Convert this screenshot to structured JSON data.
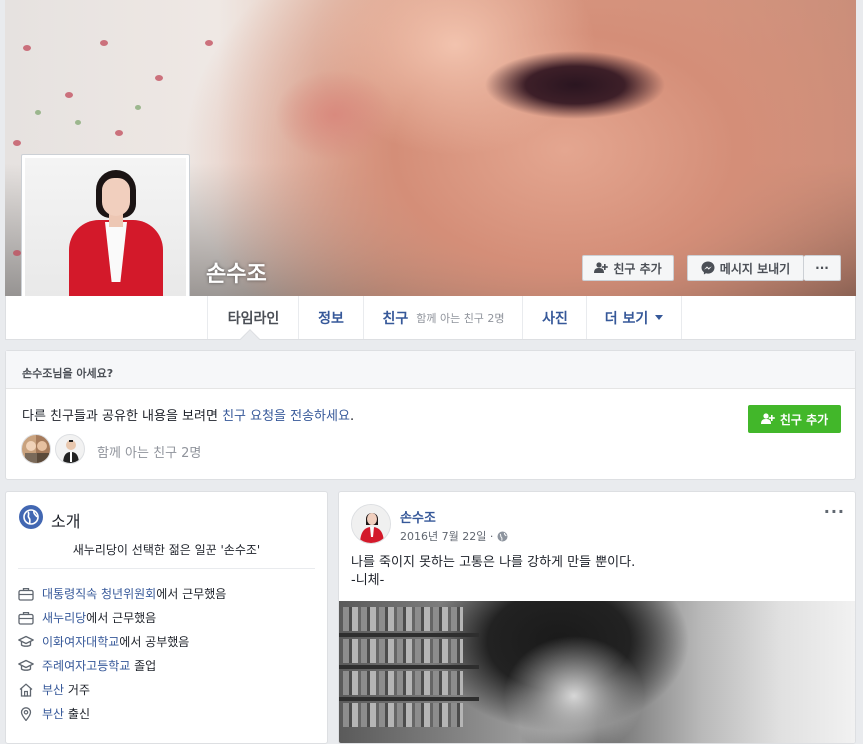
{
  "profile": {
    "name": "손수조"
  },
  "cover_actions": {
    "add_friend": "친구 추가",
    "message": "메시지 보내기",
    "more": "···"
  },
  "tabs": [
    {
      "label": "타임라인"
    },
    {
      "label": "정보"
    },
    {
      "label": "친구",
      "sub": "함께 아는 친구 2명"
    },
    {
      "label": "사진"
    },
    {
      "label": "더 보기"
    }
  ],
  "know_box": {
    "title": "손수조님을 아세요?",
    "text_prefix": "다른 친구들과 공유한 내용을 보려면 ",
    "text_link": "친구 요청을 전송하세요",
    "text_suffix": ".",
    "button": "친구 추가",
    "mutual": "함께 아는 친구 2명"
  },
  "intro": {
    "title": "소개",
    "bio": "새누리당이 선택한 젊은 일꾼 '손수조'",
    "items": [
      {
        "icon": "briefcase-icon",
        "link": "대통령직속 청년위원회",
        "text": "에서 근무했음"
      },
      {
        "icon": "briefcase-icon",
        "link": "새누리당",
        "text": "에서 근무했음"
      },
      {
        "icon": "graduation-cap-icon",
        "link": "이화여자대학교",
        "text": "에서 공부했음"
      },
      {
        "icon": "graduation-cap-icon",
        "link": "주례여자고등학교",
        "text": " 졸업"
      },
      {
        "icon": "home-icon",
        "link": "부산",
        "text": " 거주"
      },
      {
        "icon": "location-pin-icon",
        "link": "부산",
        "text": " 출신"
      }
    ]
  },
  "post": {
    "author": "손수조",
    "date": "2016년 7월 22일 ·",
    "line1": "나를 죽이지 못하는 고통은 나를 강하게 만들 뿐이다.",
    "line2": "-니체-",
    "more": "···"
  },
  "colors": {
    "link": "#365899",
    "green": "#42b72a",
    "background": "#e9ebee"
  }
}
